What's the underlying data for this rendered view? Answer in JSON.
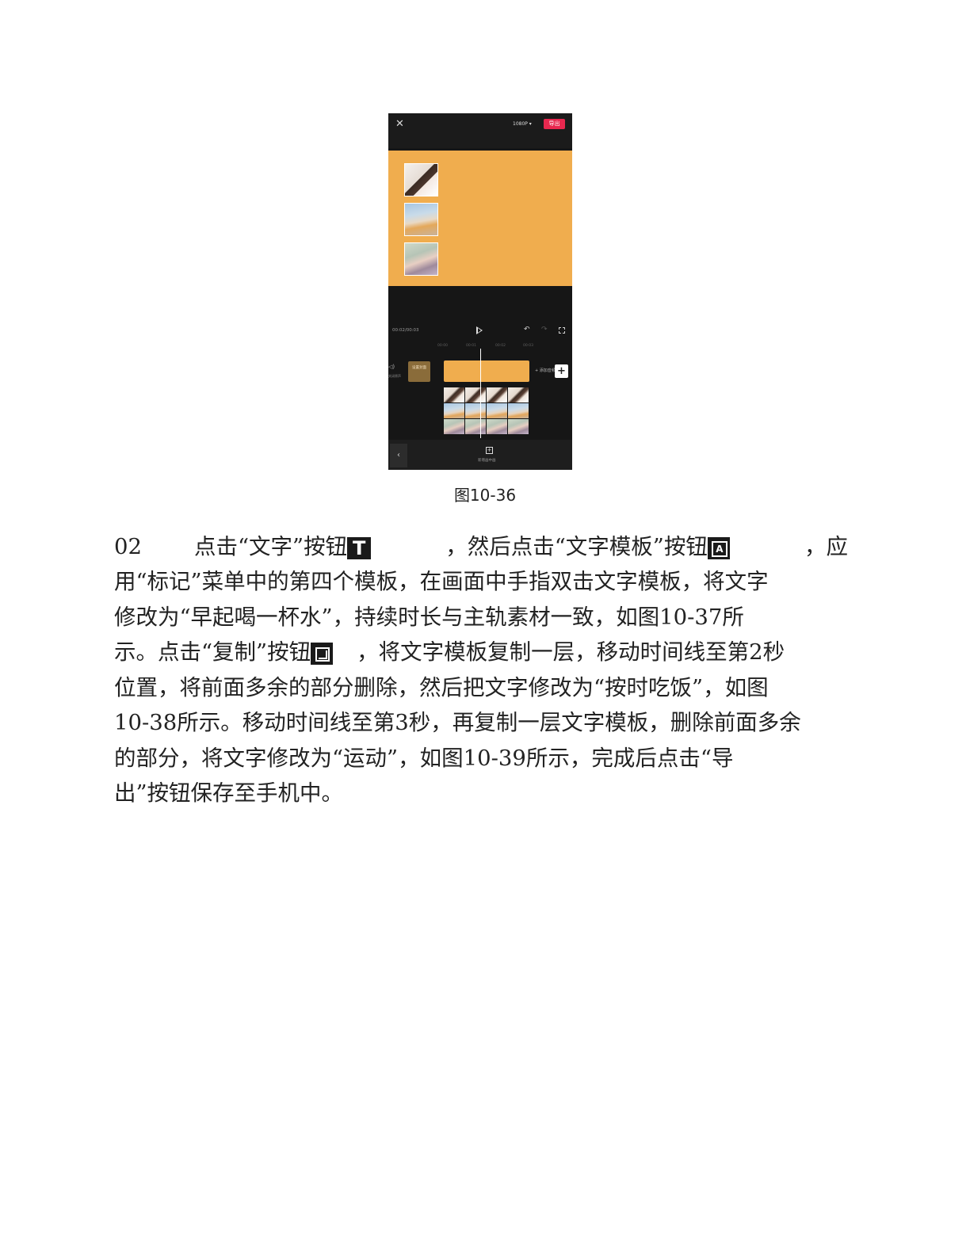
{
  "phone": {
    "resolution": "1080P ▾",
    "export_label": "导出",
    "timecode": "00:02/00:03",
    "ruler_ticks": [
      "00:00",
      "00:01",
      "00:02",
      "00:03"
    ],
    "mute_label": "关闭原声",
    "cover_label": "设置封面",
    "add_audio_label": "+ 添加音频",
    "add_button": "+",
    "new_track_label": "新增画中画"
  },
  "caption": "图10-36",
  "body": {
    "step": "02",
    "l1_a": "点击“文字”按钮",
    "l1_b": "，然后点击“文字模板”按钮",
    "l1_c": "，应",
    "l2": "用“标记”菜单中的第四个模板，在画面中手指双击文字模板，将文字",
    "l3": "修改为“早起喝一杯水”，持续时长与主轨素材一致，如图10-37所",
    "l4_a": "示。点击“复制”按钮",
    "l4_b": "，将文字模板复制一层，移动时间线至第2秒",
    "l5": "位置，将前面多余的部分删除，然后把文字修改为“按时吃饭”，如图",
    "l6": "10-38所示。移动时间线至第3秒，再复制一层文字模板，删除前面多余",
    "l7": "的部分，将文字修改为“运动”，如图10-39所示，完成后点击“导",
    "l8": "出”按钮保存至手机中。"
  },
  "icons": {
    "text_button": "T",
    "text_template_button": "A"
  }
}
